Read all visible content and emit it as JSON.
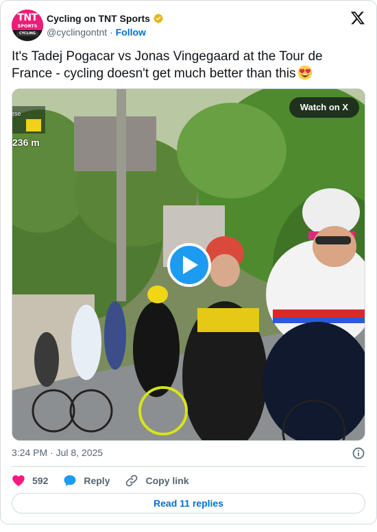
{
  "account": {
    "display_name": "Cycling on TNT Sports",
    "handle": "@cyclingontnt",
    "separator": "·",
    "follow_label": "Follow",
    "avatar_text_main": "TNT",
    "avatar_text_sub": "SPORTS",
    "avatar_text_badge": "CYCLING"
  },
  "tweet": {
    "text": "It's Tadej Pogacar vs Jonas Vingegaard at the Tour de France - cycling doesn't get much better than this",
    "emoji": "heart-eyes"
  },
  "media": {
    "watch_label": "Watch on X",
    "overlay_label": "rse",
    "overlay_distance": "236 m"
  },
  "meta": {
    "timestamp": "3:24 PM · Jul 8, 2025"
  },
  "actions": {
    "like_count": "592",
    "reply_label": "Reply",
    "copy_label": "Copy link"
  },
  "footer": {
    "read_replies_label": "Read 11 replies"
  },
  "colors": {
    "brand_pink": "#ec1e79",
    "link_blue": "#006fd6",
    "play_blue": "#1d9bf0",
    "like_red": "#f91880",
    "muted": "#536471",
    "border": "#cfd9de"
  }
}
